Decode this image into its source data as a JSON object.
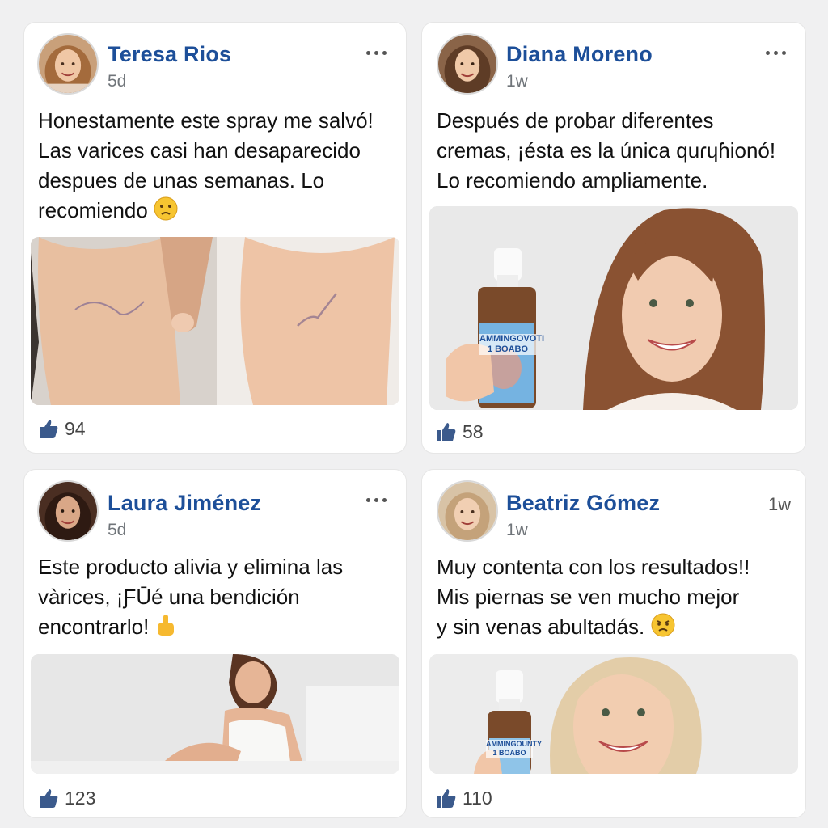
{
  "posts": [
    {
      "author": "Teresa Rios",
      "time": "5d",
      "text": "Honestamente este spray me salvó!\nLas varices casi han desaparecido\ndespues de unas semanas. Lo\nrecomiendo",
      "likes": "94",
      "emoji_icon": "worried-face-icon"
    },
    {
      "author": "Diana Moreno",
      "time": "1w",
      "text": "Después de probar diferentes\ncremas, ¡ésta es la única quɾɥɦionó!\nLo recomiendo ampliamente.",
      "likes": "58",
      "product_label": "AMMINGOVOTI\n1 BOABO"
    },
    {
      "author": "Laura Jiménez",
      "time": "5d",
      "text": "Este producto alivia y elimina las\nvàrices, ¡ƑŪé una bendición\nencontrarlo!",
      "likes": "123",
      "emoji_icon": "hand-icon"
    },
    {
      "author": "Beatriz Gómez",
      "time": "1w",
      "time_right": "1w",
      "text": "Muy contenta con los resultados!!\nMis piernas se ven mucho mejor\ny sin venas abultadás.",
      "likes": "110",
      "emoji_icon": "frowning-face-icon",
      "product_label": "AMMINGOUNTY\n1 BOABO"
    }
  ],
  "colors": {
    "author_name": "#1d4f99",
    "like_icon": "#3b5a8c",
    "background": "#f0f0f1"
  }
}
